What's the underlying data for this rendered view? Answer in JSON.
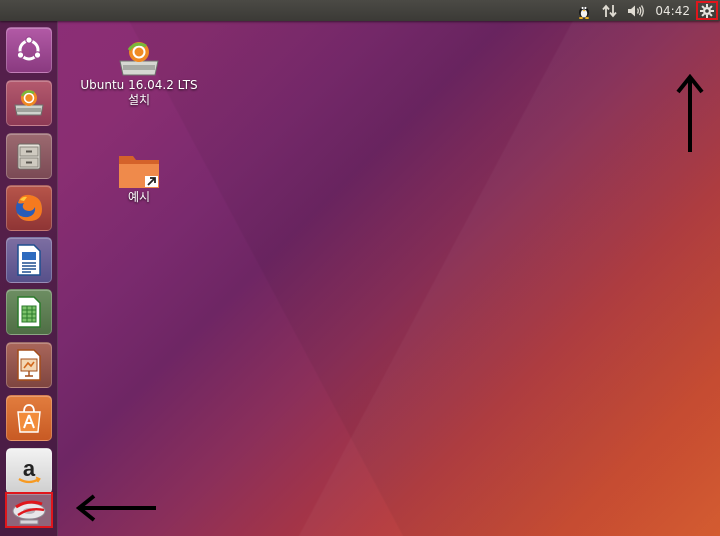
{
  "top_panel": {
    "clock": "04:42",
    "indicators": [
      "tux-icon",
      "network-updown-icon",
      "volume-icon",
      "session-gear-icon"
    ]
  },
  "launcher": {
    "items": [
      {
        "name": "dash-ubuntu-button",
        "icon": "ubuntu-logo-icon"
      },
      {
        "name": "install-ubuntu-launcher",
        "icon": "installer-drive-icon"
      },
      {
        "name": "files-launcher",
        "icon": "file-cabinet-icon"
      },
      {
        "name": "firefox-launcher",
        "icon": "firefox-icon"
      },
      {
        "name": "writer-launcher",
        "icon": "libreoffice-writer-icon"
      },
      {
        "name": "calc-launcher",
        "icon": "libreoffice-calc-icon"
      },
      {
        "name": "impress-launcher",
        "icon": "libreoffice-impress-icon"
      },
      {
        "name": "software-center-launcher",
        "icon": "shopping-bag-icon"
      },
      {
        "name": "amazon-launcher",
        "icon": "amazon-icon"
      },
      {
        "name": "optical-drive-launcher",
        "icon": "dvd-drive-icon"
      }
    ]
  },
  "desktop": {
    "icons": [
      {
        "label_line1": "Ubuntu 16.04.2 LTS",
        "label_line2": "설치"
      },
      {
        "label_line1": "예시"
      }
    ]
  },
  "annotations": {
    "highlight_color": "#e0161c",
    "arrow_color": "#000000"
  }
}
